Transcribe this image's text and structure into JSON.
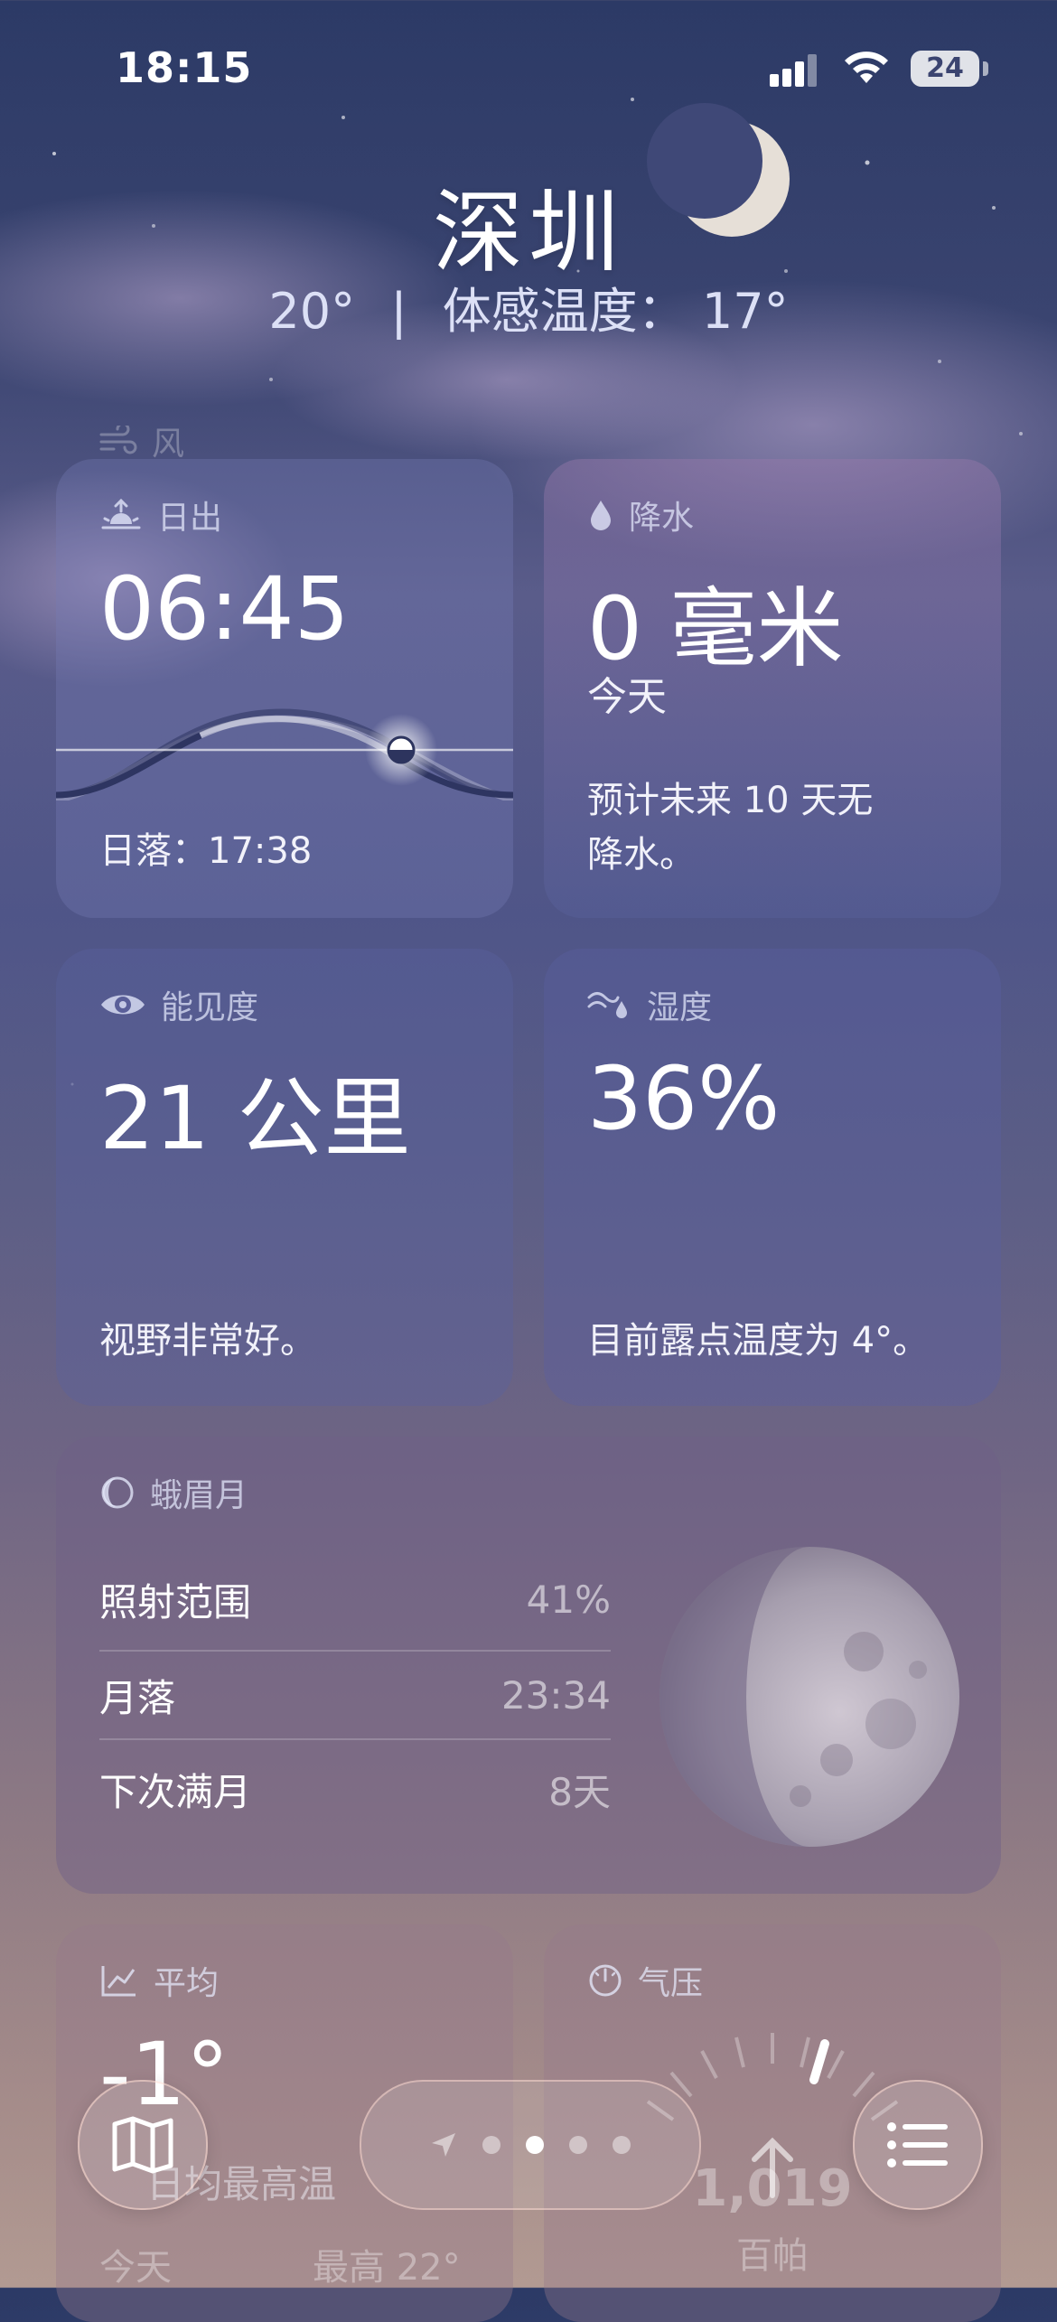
{
  "status_bar": {
    "time": "18:15",
    "battery": "24"
  },
  "header": {
    "city": "深圳",
    "temp": "20°",
    "separator": "|",
    "feels_like_label": "体感温度：",
    "feels_like_value": "17°"
  },
  "faded_section_label": "风",
  "sunrise_card": {
    "label": "日出",
    "time": "06:45",
    "sunset_label": "日落：",
    "sunset_time": "17:38"
  },
  "precip_card": {
    "label": "降水",
    "value": "0 毫米",
    "period": "今天",
    "forecast_line1": "预计未来 10 天无",
    "forecast_line2": "降水。"
  },
  "visibility_card": {
    "label": "能见度",
    "value": "21 公里",
    "note": "视野非常好。"
  },
  "humidity_card": {
    "label": "湿度",
    "value": "36%",
    "note": "目前露点温度为 4°。"
  },
  "moon_card": {
    "label": "蛾眉月",
    "rows": [
      {
        "label": "照射范围",
        "value": "41%"
      },
      {
        "label": "月落",
        "value": "23:34"
      },
      {
        "label": "下次满月",
        "value": "8天"
      }
    ]
  },
  "average_card": {
    "label": "平均",
    "value": "-1°",
    "subtitle": "日均最高温",
    "today_label": "今天",
    "high_label": "最高 22°"
  },
  "pressure_card": {
    "label": "气压",
    "value": "1,019",
    "unit": "百帕"
  },
  "bottom_bar": {
    "page_count": 4,
    "active_page": 2
  },
  "colors": {
    "accent_glass_border": "#ffd8cf",
    "card_bg": "#7882be",
    "label_text": "#e8ecff"
  }
}
